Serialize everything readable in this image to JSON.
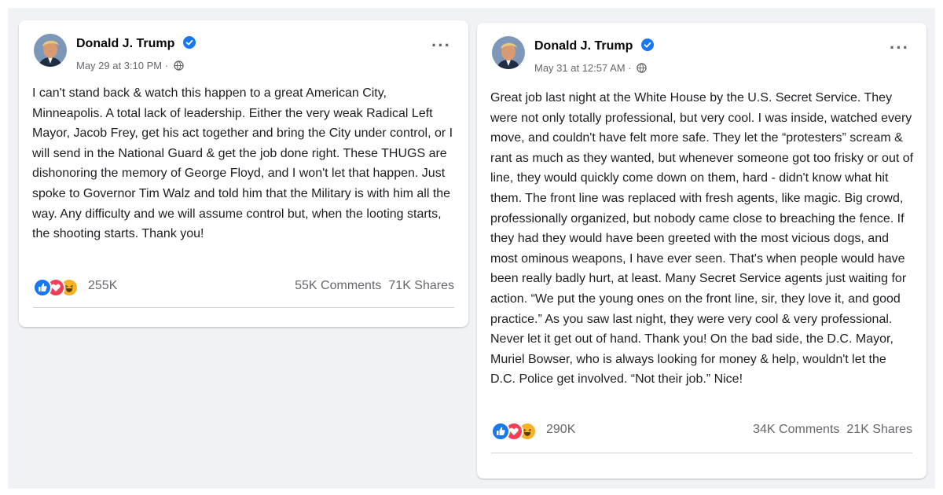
{
  "posts": [
    {
      "author": "Donald J. Trump",
      "timestamp": "May 29 at 3:10 PM · ",
      "audience_icon": "globe-icon",
      "verified_icon": "verified-badge-icon",
      "body": "I can't stand back & watch this happen to a great American City, Minneapolis. A total lack of leadership. Either the very weak Radical Left Mayor, Jacob Frey, get his act together and bring the City under control, or I will send in the National Guard & get the job done right. These THUGS are dishonoring the memory of George Floyd, and I won't let that happen. Just spoke to Governor Tim Walz and told him that the Military is with him all the way. Any difficulty and we will assume control but, when the looting starts, the shooting starts. Thank you!",
      "reaction_count": "255K",
      "comments": "55K Comments",
      "shares": "71K Shares"
    },
    {
      "author": "Donald J. Trump",
      "timestamp": "May 31 at 12:57 AM · ",
      "audience_icon": "globe-icon",
      "verified_icon": "verified-badge-icon",
      "body": "Great job last night at the White House by the U.S. Secret Service. They were not only totally professional, but very cool. I was inside, watched every move, and couldn't have felt more safe. They let the “protesters” scream & rant as much as they wanted, but whenever someone got too frisky or out of line, they would quickly come down on them, hard - didn't know what hit them. The front line was replaced with fresh agents, like magic. Big crowd, professionally organized, but nobody came close to breaching the fence. If they had they would have been greeted with the most vicious dogs, and most ominous weapons, I have ever seen. That's when people would have been really badly hurt, at least. Many Secret Service agents just waiting for action. “We put the young ones on the front line, sir, they love it, and good practice.” As you saw last night, they were very cool & very professional. Never let it get out of hand. Thank you! On the bad side, the D.C. Mayor, Muriel Bowser, who is always looking for money & help, wouldn't let the D.C. Police get involved. “Not their job.” Nice!",
      "reaction_count": "290K",
      "comments": "34K Comments",
      "shares": "21K Shares"
    }
  ],
  "reaction_icons": [
    "like-icon",
    "love-icon",
    "haha-icon"
  ],
  "more_label": "···",
  "colors": {
    "background": "#f0f2f5",
    "card": "#ffffff",
    "text": "#1c1e21",
    "secondary": "#65676b",
    "verified": "#1877f2",
    "like": "#1877f2",
    "love": "#f33e58",
    "haha": "#f7b125"
  }
}
